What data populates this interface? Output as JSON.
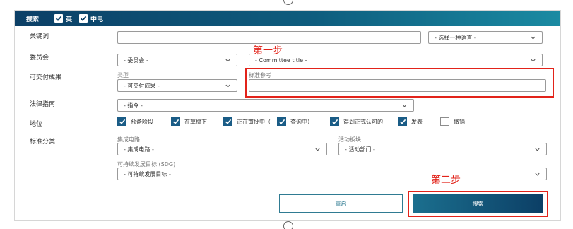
{
  "header": {
    "title": "搜索",
    "checks": [
      {
        "label": "英",
        "checked": true
      },
      {
        "label": "中电",
        "checked": true
      }
    ]
  },
  "keyword": {
    "label": "关键词",
    "value": "",
    "language_select": "- 选择一种语言 -"
  },
  "committee": {
    "label": "委员会",
    "select": "- 委员会 -",
    "title_select": "- Committee title -"
  },
  "deliverables": {
    "label": "可交付成果",
    "type_label": "类型",
    "type_select": "- 可交付成果 -",
    "ref_label": "标准参考",
    "ref_value": ""
  },
  "legal": {
    "label": "法律指南",
    "select": "- 指令 -"
  },
  "status": {
    "label": "地位",
    "options": [
      {
        "label": "预备阶段",
        "checked": true
      },
      {
        "label": "在草稿下",
        "checked": true
      },
      {
        "label": "正在审批中（",
        "checked": true
      },
      {
        "label": "查询中）",
        "checked": true
      },
      {
        "label": "得到正式认可的",
        "checked": true
      },
      {
        "label": "发表",
        "checked": true
      },
      {
        "label": "撤销",
        "checked": false
      }
    ]
  },
  "classification": {
    "label": "标准分类",
    "ic_label": "集成电路",
    "ic_select": "- 集成电路 -",
    "area_label": "活动板块",
    "area_select": "- 活动部门 -",
    "sdg_label": "可持续发展目标 (SDG)",
    "sdg_select": "- 可持续发展目标 -"
  },
  "buttons": {
    "reset": "重启",
    "search": "搜索"
  },
  "annotations": {
    "step1": "第一步",
    "step2": "第二步"
  },
  "colors": {
    "header": "#0c3f66",
    "accent": "#1a5c86",
    "annotation": "#e2231a"
  }
}
